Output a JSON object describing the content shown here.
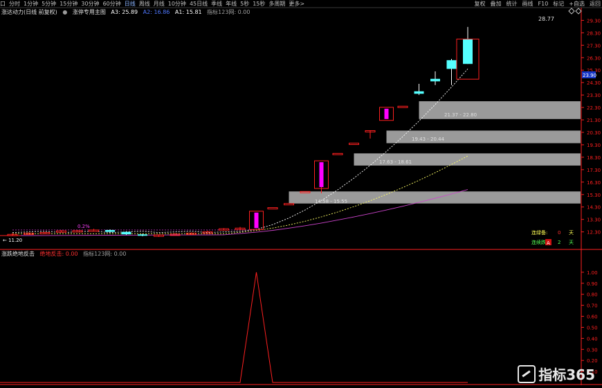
{
  "toolbar": {
    "left": [
      "口",
      "分时",
      "1分钟",
      "5分钟",
      "15分钟",
      "30分钟",
      "60分钟",
      "日线",
      "周线",
      "月线",
      "10分钟",
      "45日线",
      "季线",
      "年线",
      "5秒",
      "15秒",
      "多周期",
      "更多>"
    ],
    "active_index": 7,
    "right": [
      "复权",
      "叠加",
      "统计",
      "画线",
      "F10",
      "标记",
      "+自选",
      "返回"
    ]
  },
  "main_info": {
    "title": "涨达动力(日线 前复权)",
    "dot": "●",
    "indicator": "涨停专用主图",
    "a3": "A3: 25.89",
    "a2": "A2: 16.86",
    "a1": "A1: 15.81",
    "zhibiao": "指标123网: 0.00"
  },
  "indicator_info": {
    "title": "涨跌绝地反击",
    "label": "绝地反击: 0.00",
    "zhibiao": "指标123网: 0.00"
  },
  "labels": {
    "high": "28.77",
    "pct": "0.2%",
    "low": "← 11.20",
    "level1": "14.58 - 15.55",
    "level2": "17.63 - 18.61",
    "level3": "19.43 - 20.44",
    "level4": "21.37 - 22.80",
    "price_tag": "23.90",
    "lianlu_label": "连绿备:",
    "lianlu_value": "0",
    "lianhong_label": "连续跌:",
    "lianhong_value": "2",
    "tian": "天",
    "corner_badge": "A",
    "brand": "指标365"
  },
  "colors": {
    "up": "#ff2020",
    "fill_up": "#ff00ff",
    "down": "#55ffff",
    "zone": "#9a9a9a",
    "ma_white": "#ffffff",
    "ma_yellow": "#ffff66",
    "ma_purple": "#cc44cc",
    "indicator_line": "#ff2020",
    "axis": "#ff2020"
  },
  "chart_data": [
    {
      "type": "candlestick",
      "ylim": [
        11.0,
        29.6
      ],
      "y_ticks": [
        29.3,
        28.3,
        27.3,
        26.3,
        25.3,
        24.3,
        23.3,
        22.3,
        21.3,
        20.3,
        19.3,
        18.3,
        17.3,
        16.3,
        15.3,
        14.3,
        13.3,
        12.3
      ],
      "candles": [
        {
          "o": 12.1,
          "c": 12.1,
          "h": 12.2,
          "l": 12.0
        },
        {
          "o": 12.15,
          "c": 12.2,
          "h": 12.25,
          "l": 12.1
        },
        {
          "o": 12.22,
          "c": 12.25,
          "h": 12.3,
          "l": 12.18
        },
        {
          "o": 12.3,
          "c": 12.38,
          "h": 12.45,
          "l": 12.25
        },
        {
          "o": 12.4,
          "c": 12.4,
          "h": 12.45,
          "l": 12.35
        },
        {
          "o": 12.45,
          "c": 12.45,
          "h": 12.55,
          "l": 12.4
        },
        {
          "o": 12.45,
          "c": 12.3,
          "h": 12.5,
          "l": 12.25
        },
        {
          "o": 12.3,
          "c": 12.1,
          "h": 12.35,
          "l": 12.05
        },
        {
          "o": 12.1,
          "c": 12.0,
          "h": 12.15,
          "l": 11.95
        },
        {
          "o": 12.0,
          "c": 12.05,
          "h": 12.1,
          "l": 11.9
        },
        {
          "o": 12.1,
          "c": 12.12,
          "h": 12.2,
          "l": 12.05
        },
        {
          "o": 12.2,
          "c": 12.2,
          "h": 12.25,
          "l": 12.1
        },
        {
          "o": 12.3,
          "c": 12.3,
          "h": 12.4,
          "l": 12.25
        },
        {
          "o": 12.5,
          "c": 12.55,
          "h": 12.6,
          "l": 12.45
        },
        {
          "o": 12.55,
          "c": 12.6,
          "h": 12.7,
          "l": 12.5
        },
        {
          "o": 12.6,
          "c": 13.85,
          "h": 13.85,
          "l": 12.6
        },
        {
          "o": 14.25,
          "c": 14.25,
          "h": 14.25,
          "l": 14.25
        },
        {
          "o": 14.58,
          "c": 14.58,
          "h": 14.58,
          "l": 14.58
        },
        {
          "o": 15.55,
          "c": 15.55,
          "h": 15.55,
          "l": 15.55
        },
        {
          "o": 15.9,
          "c": 17.9,
          "h": 17.9,
          "l": 15.4
        },
        {
          "o": 18.61,
          "c": 18.61,
          "h": 18.61,
          "l": 18.61
        },
        {
          "o": 19.43,
          "c": 19.43,
          "h": 19.43,
          "l": 19.43
        },
        {
          "o": 20.44,
          "c": 20.44,
          "h": 20.44,
          "l": 19.8
        },
        {
          "o": 21.37,
          "c": 22.2,
          "h": 22.2,
          "l": 21.37
        },
        {
          "o": 22.4,
          "c": 22.4,
          "h": 22.4,
          "l": 22.4
        },
        {
          "o": 23.6,
          "c": 23.4,
          "h": 24.2,
          "l": 23.3
        },
        {
          "o": 24.6,
          "c": 24.4,
          "h": 25.2,
          "l": 24.1
        },
        {
          "o": 26.1,
          "c": 25.4,
          "h": 26.2,
          "l": 24.1
        },
        {
          "o": 27.8,
          "c": 25.8,
          "h": 28.77,
          "l": 25.8
        }
      ],
      "zones": [
        {
          "low": 14.58,
          "high": 15.55
        },
        {
          "low": 17.63,
          "high": 18.61
        },
        {
          "low": 19.43,
          "high": 20.44
        },
        {
          "low": 21.37,
          "high": 22.8
        }
      ]
    },
    {
      "type": "line",
      "ylim": [
        0,
        1.1
      ],
      "y_ticks": [
        1.0,
        0.9,
        0.8,
        0.7,
        0.6,
        0.5,
        0.4,
        0.3,
        0.2,
        0.1
      ],
      "values": [
        0,
        0,
        0,
        0,
        0,
        0,
        0,
        0,
        0,
        0,
        0,
        0,
        0,
        0,
        0,
        1,
        0,
        0,
        0,
        0,
        0,
        0,
        0,
        0,
        0,
        0,
        0,
        0,
        0
      ]
    }
  ]
}
